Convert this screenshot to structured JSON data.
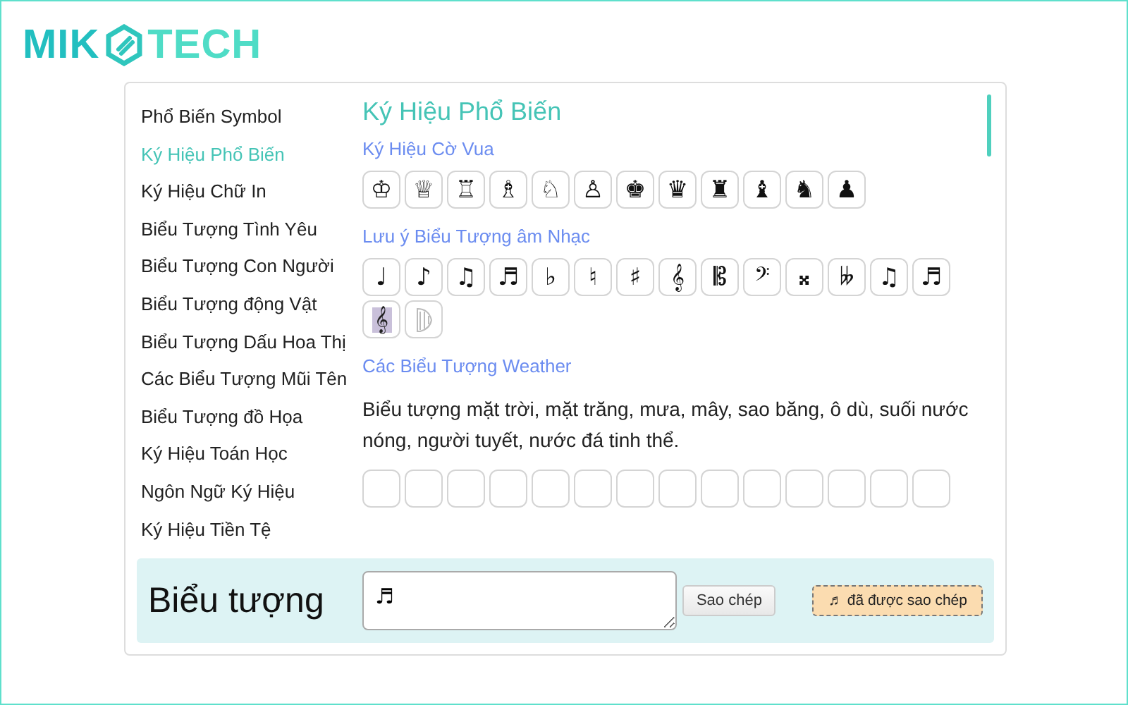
{
  "logo": {
    "left": "MIK",
    "right": "TECH"
  },
  "sidebar": {
    "items": [
      {
        "label": "Phổ Biến Symbol",
        "selected": false
      },
      {
        "label": "Ký Hiệu Phổ Biến",
        "selected": true
      },
      {
        "label": "Ký Hiệu Chữ In",
        "selected": false
      },
      {
        "label": "Biểu Tượng Tình Yêu",
        "selected": false
      },
      {
        "label": "Biểu Tượng Con Người",
        "selected": false
      },
      {
        "label": "Biểu Tượng động Vật",
        "selected": false
      },
      {
        "label": "Biểu Tượng Dấu Hoa Thị",
        "selected": false
      },
      {
        "label": "Các Biểu Tượng Mũi Tên",
        "selected": false
      },
      {
        "label": "Biểu Tượng đồ Họa",
        "selected": false
      },
      {
        "label": "Ký Hiệu Toán Học",
        "selected": false
      },
      {
        "label": "Ngôn Ngữ Ký Hiệu",
        "selected": false
      },
      {
        "label": "Ký Hiệu Tiền Tệ",
        "selected": false
      }
    ]
  },
  "content": {
    "title": "Ký Hiệu Phổ Biến",
    "sections": [
      {
        "heading": "Ký Hiệu Cờ Vua",
        "symbols": [
          {
            "kind": "glyph",
            "char": "♔"
          },
          {
            "kind": "glyph",
            "char": "♕"
          },
          {
            "kind": "glyph",
            "char": "♖"
          },
          {
            "kind": "glyph",
            "char": "♗"
          },
          {
            "kind": "glyph",
            "char": "♘"
          },
          {
            "kind": "glyph",
            "char": "♙"
          },
          {
            "kind": "glyph",
            "char": "♚"
          },
          {
            "kind": "glyph",
            "char": "♛"
          },
          {
            "kind": "glyph",
            "char": "♜"
          },
          {
            "kind": "glyph",
            "char": "♝"
          },
          {
            "kind": "glyph",
            "char": "♞"
          },
          {
            "kind": "glyph",
            "char": "♟"
          }
        ]
      },
      {
        "heading": "Lưu ý Biểu Tượng âm Nhạc",
        "symbols": [
          {
            "kind": "glyph",
            "char": "♩"
          },
          {
            "kind": "glyph",
            "char": "♪"
          },
          {
            "kind": "glyph",
            "char": "♫"
          },
          {
            "kind": "glyph",
            "char": "♬"
          },
          {
            "kind": "glyph",
            "char": "♭"
          },
          {
            "kind": "glyph",
            "char": "♮"
          },
          {
            "kind": "glyph",
            "char": "♯"
          },
          {
            "kind": "glyph",
            "char": "𝄞"
          },
          {
            "kind": "glyph",
            "char": "𝄡"
          },
          {
            "kind": "glyph",
            "char": "𝄢"
          },
          {
            "kind": "glyph",
            "char": "𝄪"
          },
          {
            "kind": "glyph",
            "char": "𝄫"
          },
          {
            "kind": "bold",
            "char": "♫"
          },
          {
            "kind": "bold",
            "char": "♬"
          },
          {
            "kind": "shaded",
            "char": "𝄞"
          },
          {
            "kind": "harp"
          }
        ]
      },
      {
        "heading": "Các Biểu Tượng Weather",
        "description": "Biểu tượng mặt trời, mặt trăng, mưa, mây, sao băng, ô dù, suối nước nóng, người tuyết, nước đá tinh thể.",
        "symbols": [
          {
            "kind": "hidden"
          },
          {
            "kind": "hidden"
          },
          {
            "kind": "hidden"
          },
          {
            "kind": "hidden"
          },
          {
            "kind": "hidden"
          },
          {
            "kind": "hidden"
          },
          {
            "kind": "hidden"
          },
          {
            "kind": "hidden"
          },
          {
            "kind": "hidden"
          },
          {
            "kind": "hidden"
          },
          {
            "kind": "hidden"
          },
          {
            "kind": "hidden"
          },
          {
            "kind": "hidden"
          },
          {
            "kind": "hidden"
          }
        ]
      }
    ]
  },
  "bottom": {
    "label": "Biểu tượng",
    "value": "♬",
    "copy_button": "Sao chép",
    "notice": "♬ đã được sao chép"
  }
}
